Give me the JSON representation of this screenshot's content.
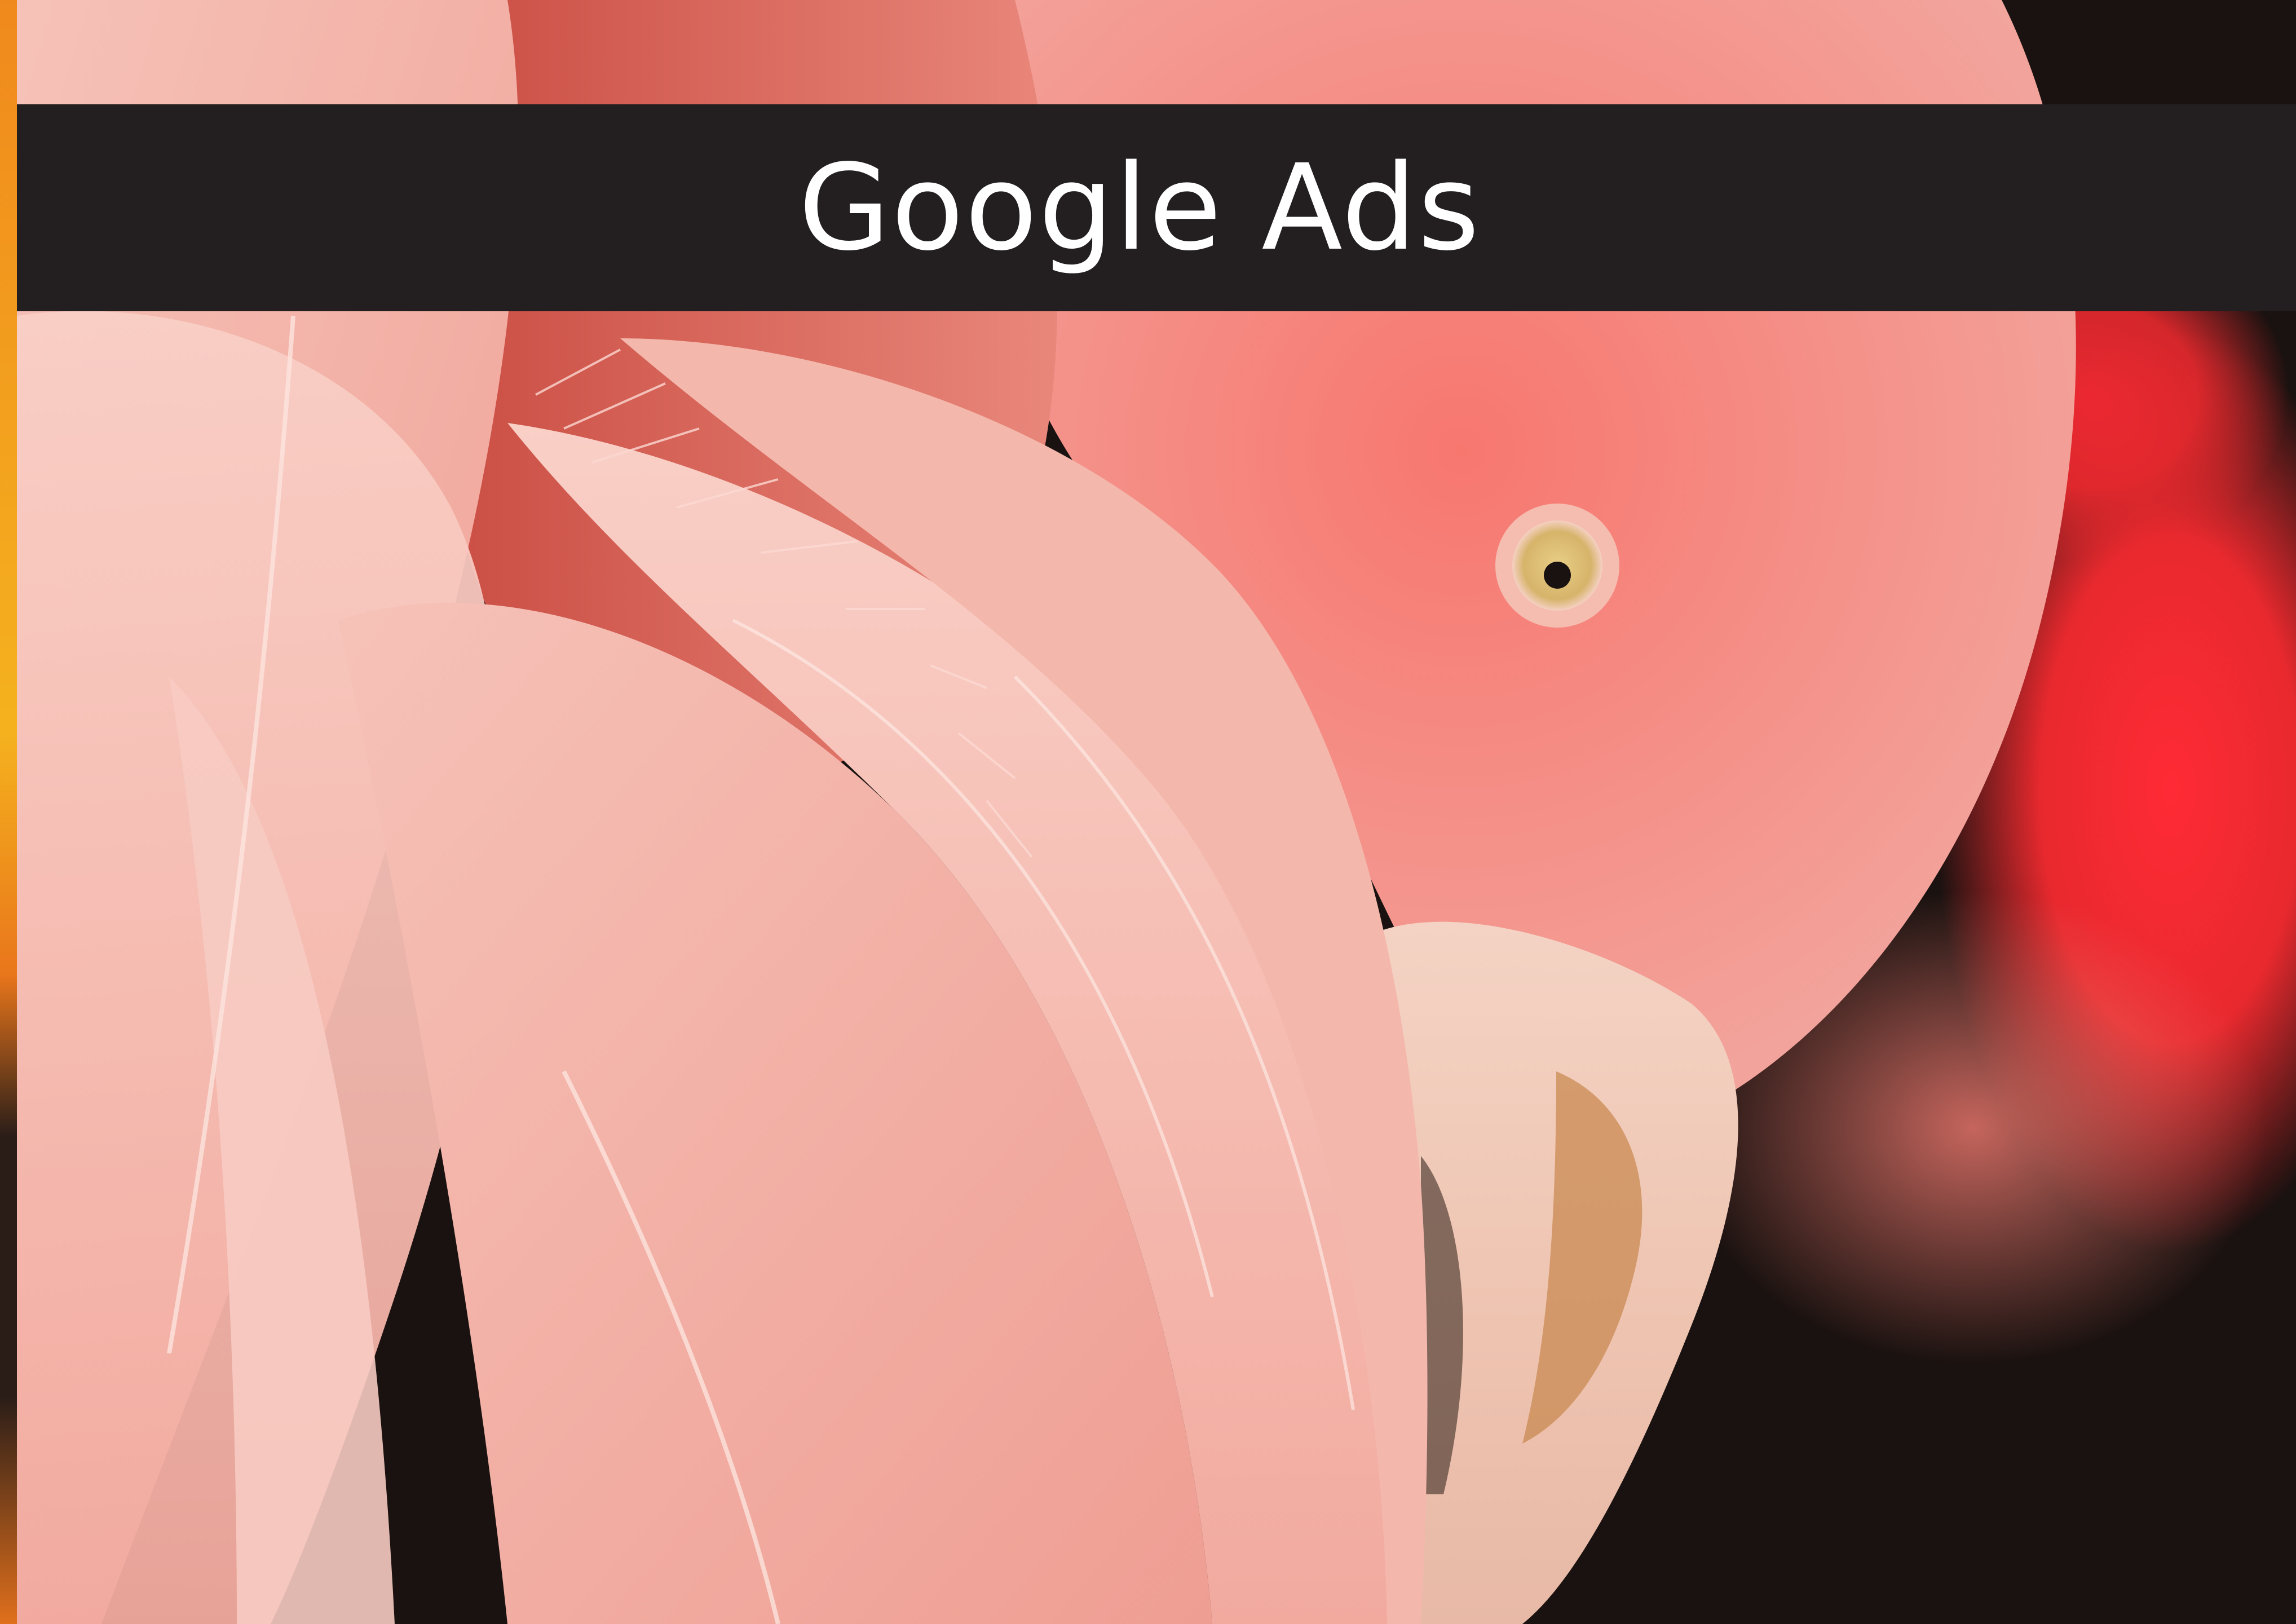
{
  "header": {
    "title": "Google Ads"
  },
  "photo": {
    "subject": "flamingo-icon",
    "colors": {
      "feather_light": "#f3b0a6",
      "feather_mid": "#ee8f84",
      "feather_deep": "#c94f46",
      "head": "#f08a82",
      "beak": "#f3d6c8",
      "eye": "#e6c77a",
      "background_red": "#e8292e",
      "background_dark": "#1a1210",
      "edge_orange": "#f08a1e"
    }
  },
  "colors": {
    "title_bar": "#231f20",
    "title_text": "#ffffff"
  }
}
